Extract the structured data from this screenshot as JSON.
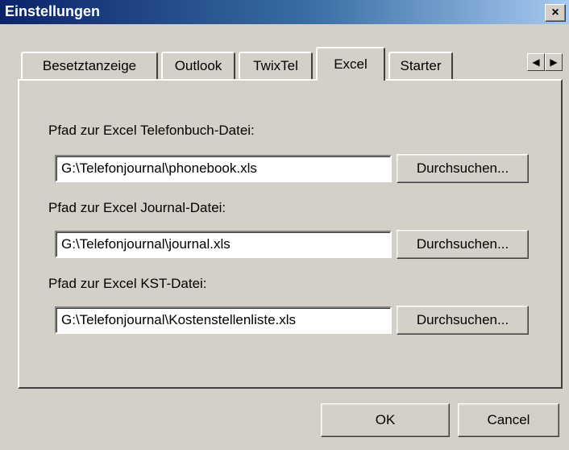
{
  "window": {
    "title": "Einstellungen",
    "close_glyph": "×"
  },
  "tabs": [
    {
      "label": "Besetztanzeige",
      "active": false
    },
    {
      "label": "Outlook",
      "active": false
    },
    {
      "label": "TwixTel",
      "active": false
    },
    {
      "label": "Excel",
      "active": true
    },
    {
      "label": "Starter",
      "active": false
    }
  ],
  "tab_scroll": {
    "left_icon": "◀",
    "right_icon": "▶"
  },
  "excel": {
    "phonebook_label": "Pfad zur Excel Telefonbuch-Datei:",
    "phonebook_path": "G:\\Telefonjournal\\phonebook.xls",
    "journal_label": "Pfad zur Excel Journal-Datei:",
    "journal_path": "G:\\Telefonjournal\\journal.xls",
    "kst_label": "Pfad zur Excel KST-Datei:",
    "kst_path": "G:\\Telefonjournal\\Kostenstellenliste.xls",
    "browse_label": "Durchsuchen..."
  },
  "footer": {
    "ok_label": "OK",
    "cancel_label": "Cancel"
  }
}
